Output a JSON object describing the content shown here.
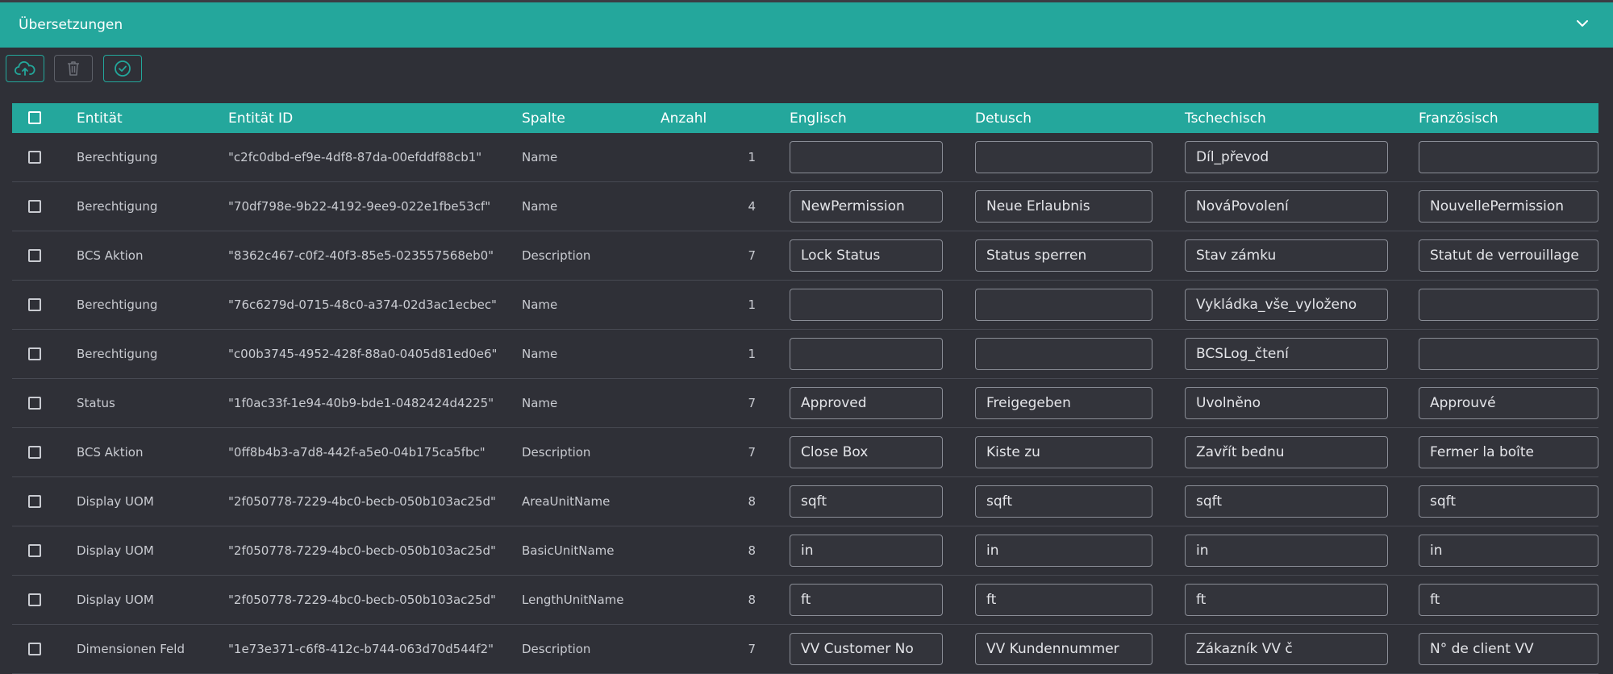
{
  "panel": {
    "title": "Übersetzungen"
  },
  "toolbar": [
    {
      "name": "upload-button",
      "icon": "cloud-upload-icon",
      "enabled": true
    },
    {
      "name": "delete-button",
      "icon": "trash-icon",
      "enabled": false
    },
    {
      "name": "approve-button",
      "icon": "check-circle-icon",
      "enabled": true
    }
  ],
  "colors": {
    "accent": "#24a79c",
    "background": "#2f3037",
    "row_border": "#474952"
  },
  "table": {
    "headers": {
      "entity": "Entität",
      "entity_id": "Entität ID",
      "column": "Spalte",
      "count": "Anzahl",
      "english": "Englisch",
      "german": "Detusch",
      "czech": "Tschechisch",
      "french": "Französisch"
    },
    "rows": [
      {
        "entity": "Berechtigung",
        "entity_id": "\"c2fc0dbd-ef9e-4df8-87da-00efddf88cb1\"",
        "column": "Name",
        "count": "1",
        "english": "",
        "german": "",
        "czech": "Díl_převod",
        "french": ""
      },
      {
        "entity": "Berechtigung",
        "entity_id": "\"70df798e-9b22-4192-9ee9-022e1fbe53cf\"",
        "column": "Name",
        "count": "4",
        "english": "NewPermission",
        "german": "Neue Erlaubnis",
        "czech": "NováPovolení",
        "french": "NouvellePermission"
      },
      {
        "entity": "BCS Aktion",
        "entity_id": "\"8362c467-c0f2-40f3-85e5-023557568eb0\"",
        "column": "Description",
        "count": "7",
        "english": "Lock Status",
        "german": "Status sperren",
        "czech": "Stav zámku",
        "french": "Statut de verrouillage"
      },
      {
        "entity": "Berechtigung",
        "entity_id": "\"76c6279d-0715-48c0-a374-02d3ac1ecbec\"",
        "column": "Name",
        "count": "1",
        "english": "",
        "german": "",
        "czech": "Vykládka_vše_vyloženo",
        "french": ""
      },
      {
        "entity": "Berechtigung",
        "entity_id": "\"c00b3745-4952-428f-88a0-0405d81ed0e6\"",
        "column": "Name",
        "count": "1",
        "english": "",
        "german": "",
        "czech": "BCSLog_čtení",
        "french": ""
      },
      {
        "entity": "Status",
        "entity_id": "\"1f0ac33f-1e94-40b9-bde1-0482424d4225\"",
        "column": "Name",
        "count": "7",
        "english": "Approved",
        "german": "Freigegeben",
        "czech": "Uvolněno",
        "french": "Approuvé"
      },
      {
        "entity": "BCS Aktion",
        "entity_id": "\"0ff8b4b3-a7d8-442f-a5e0-04b175ca5fbc\"",
        "column": "Description",
        "count": "7",
        "english": "Close Box",
        "german": "Kiste zu",
        "czech": "Zavřít bednu",
        "french": "Fermer la boîte"
      },
      {
        "entity": "Display UOM",
        "entity_id": "\"2f050778-7229-4bc0-becb-050b103ac25d\"",
        "column": "AreaUnitName",
        "count": "8",
        "english": "sqft",
        "german": "sqft",
        "czech": "sqft",
        "french": "sqft"
      },
      {
        "entity": "Display UOM",
        "entity_id": "\"2f050778-7229-4bc0-becb-050b103ac25d\"",
        "column": "BasicUnitName",
        "count": "8",
        "english": "in",
        "german": "in",
        "czech": "in",
        "french": "in"
      },
      {
        "entity": "Display UOM",
        "entity_id": "\"2f050778-7229-4bc0-becb-050b103ac25d\"",
        "column": "LengthUnitName",
        "count": "8",
        "english": "ft",
        "german": "ft",
        "czech": "ft",
        "french": "ft"
      },
      {
        "entity": "Dimensionen Feld",
        "entity_id": "\"1e73e371-c6f8-412c-b744-063d70d544f2\"",
        "column": "Description",
        "count": "7",
        "english": "VV Customer No",
        "german": "VV Kundennummer",
        "czech": "Zákazník VV č",
        "french": "N° de client VV"
      }
    ]
  }
}
